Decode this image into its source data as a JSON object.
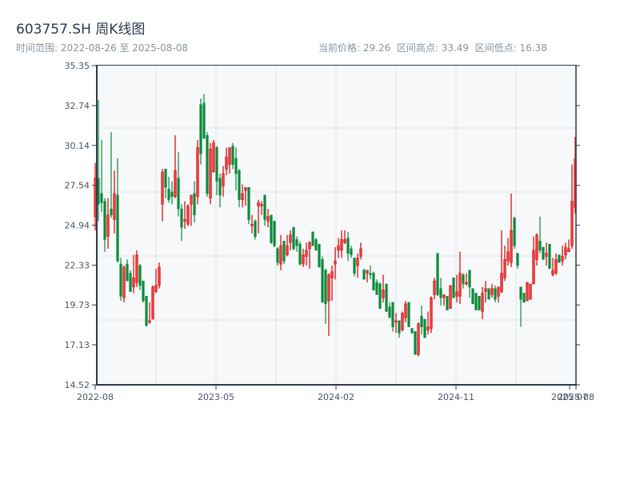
{
  "header": {
    "title": "603757.SH 周K线图",
    "range_text": "时间范围: 2022-08-26 至 2025-08-08",
    "stats_text": "当前价格: 29.26  区间高点: 33.49  区间低点: 16.38"
  },
  "colors": {
    "up": "#d40000",
    "up_fill": "#ee3a3a",
    "down": "#0b8a3b",
    "plot_bg": "#f6f8fa",
    "grid": "#e1e4ea",
    "axis": "#2b3a4e"
  },
  "chart_data": {
    "type": "candlestick",
    "title": "603757.SH 周K线图",
    "start_date": "2022-08-26",
    "end_date": "2025-08-08",
    "frequency": "weekly",
    "current_price": 29.26,
    "period_high": 33.49,
    "period_low": 16.38,
    "ylim": [
      14.52,
      35.35
    ],
    "y_ticks": [
      "14.52",
      "17.13",
      "19.73",
      "22.33",
      "24.94",
      "27.54",
      "30.14",
      "32.74",
      "35.35"
    ],
    "x_ticks": [
      {
        "label": "2022-08",
        "index": 0
      },
      {
        "label": "2023-05",
        "index": 37.75
      },
      {
        "label": "2024-02",
        "index": 75.25
      },
      {
        "label": "2024-11",
        "index": 112.75
      },
      {
        "label": "2025-07",
        "index": 148.25
      },
      {
        "label": "2025-08",
        "index": 150.25
      }
    ],
    "ohlc_fields": [
      "open",
      "high",
      "low",
      "close"
    ],
    "candles": [
      [
        25.5,
        29.0,
        24.6,
        28.0
      ],
      [
        28.0,
        33.1,
        25.2,
        26.3
      ],
      [
        27.0,
        30.5,
        25.8,
        26.4
      ],
      [
        26.5,
        26.7,
        23.2,
        24.0
      ],
      [
        24.2,
        26.7,
        23.4,
        25.6
      ],
      [
        26.0,
        31.0,
        25.4,
        25.6
      ],
      [
        25.3,
        28.5,
        24.4,
        27.0
      ],
      [
        26.9,
        29.3,
        22.5,
        22.6
      ],
      [
        22.4,
        22.8,
        20.0,
        20.3
      ],
      [
        20.2,
        22.3,
        19.9,
        22.2
      ],
      [
        22.4,
        22.7,
        21.3,
        21.3
      ],
      [
        21.8,
        22.0,
        20.6,
        20.6
      ],
      [
        20.9,
        23.0,
        20.5,
        21.5
      ],
      [
        21.2,
        23.3,
        20.9,
        23.0
      ],
      [
        22.3,
        22.4,
        20.7,
        21.0
      ],
      [
        21.3,
        21.3,
        19.9,
        20.0
      ],
      [
        20.3,
        20.3,
        18.3,
        18.4
      ],
      [
        18.6,
        19.9,
        18.5,
        18.7
      ],
      [
        18.8,
        21.0,
        18.8,
        20.9
      ],
      [
        20.6,
        22.1,
        20.5,
        21.0
      ],
      [
        21.0,
        22.5,
        20.8,
        22.2
      ],
      [
        26.3,
        28.6,
        25.2,
        28.4
      ],
      [
        28.6,
        28.6,
        26.7,
        27.4
      ],
      [
        27.3,
        28.1,
        26.4,
        26.6
      ],
      [
        27.1,
        27.8,
        26.3,
        26.8
      ],
      [
        26.8,
        30.8,
        26.7,
        28.5
      ],
      [
        28.0,
        29.7,
        25.5,
        26.0
      ],
      [
        26.0,
        26.3,
        23.9,
        24.8
      ],
      [
        25.2,
        26.5,
        24.7,
        25.3
      ],
      [
        25.0,
        26.3,
        24.9,
        26.2
      ],
      [
        26.3,
        26.9,
        24.9,
        26.9
      ],
      [
        27.0,
        27.8,
        25.1,
        25.6
      ],
      [
        26.8,
        30.5,
        26.3,
        30.0
      ],
      [
        32.8,
        33.2,
        28.9,
        29.6
      ],
      [
        32.9,
        33.49,
        30.6,
        30.6
      ],
      [
        30.8,
        31.0,
        26.8,
        27.0
      ],
      [
        26.7,
        30.3,
        26.3,
        29.9
      ],
      [
        28.4,
        30.5,
        28.4,
        30.3
      ],
      [
        30.0,
        30.1,
        26.9,
        27.8
      ],
      [
        28.0,
        28.3,
        26.1,
        26.9
      ],
      [
        27.5,
        28.8,
        26.8,
        28.3
      ],
      [
        28.6,
        30.0,
        28.2,
        29.4
      ],
      [
        28.9,
        30.0,
        28.3,
        30.0
      ],
      [
        30.1,
        30.3,
        28.6,
        28.9
      ],
      [
        29.3,
        30.0,
        27.2,
        28.3
      ],
      [
        28.5,
        28.6,
        26.1,
        26.6
      ],
      [
        26.6,
        27.6,
        26.1,
        27.0
      ],
      [
        27.2,
        27.4,
        26.2,
        27.4
      ],
      [
        27.4,
        27.4,
        25.0,
        25.3
      ],
      [
        24.9,
        25.6,
        24.4,
        25.0
      ],
      [
        25.2,
        25.3,
        24.0,
        24.2
      ],
      [
        26.2,
        26.6,
        24.4,
        26.4
      ],
      [
        26.2,
        26.5,
        25.6,
        26.3
      ],
      [
        26.9,
        26.9,
        24.9,
        25.3
      ],
      [
        25.2,
        26.0,
        24.8,
        25.5
      ],
      [
        25.6,
        25.6,
        23.7,
        23.8
      ],
      [
        25.2,
        25.2,
        23.5,
        23.6
      ],
      [
        23.4,
        23.5,
        22.3,
        22.5
      ],
      [
        22.4,
        24.3,
        22.0,
        23.6
      ],
      [
        23.9,
        23.9,
        22.4,
        22.6
      ],
      [
        23.0,
        24.3,
        22.9,
        23.6
      ],
      [
        23.8,
        24.6,
        23.3,
        24.3
      ],
      [
        24.8,
        24.8,
        23.3,
        23.4
      ],
      [
        24.0,
        24.2,
        23.2,
        23.6
      ],
      [
        23.7,
        23.9,
        22.3,
        22.4
      ],
      [
        22.4,
        23.4,
        22.2,
        23.0
      ],
      [
        22.9,
        23.8,
        22.3,
        23.3
      ],
      [
        23.4,
        23.9,
        22.1,
        23.8
      ],
      [
        24.5,
        24.5,
        23.6,
        23.6
      ],
      [
        24.0,
        24.1,
        23.3,
        23.3
      ],
      [
        23.7,
        23.7,
        22.2,
        22.2
      ],
      [
        22.7,
        22.9,
        19.9,
        19.9
      ],
      [
        22.0,
        22.1,
        18.5,
        19.8
      ],
      [
        20.0,
        21.8,
        17.7,
        21.7
      ],
      [
        21.5,
        22.3,
        20.0,
        21.9
      ],
      [
        22.4,
        23.5,
        21.4,
        22.6
      ],
      [
        23.3,
        24.1,
        22.8,
        23.6
      ],
      [
        23.3,
        24.6,
        22.8,
        24.0
      ],
      [
        23.8,
        24.6,
        23.7,
        24.0
      ],
      [
        24.1,
        24.5,
        22.6,
        23.1
      ],
      [
        23.4,
        23.6,
        22.8,
        23.0
      ],
      [
        22.8,
        22.8,
        21.6,
        21.8
      ],
      [
        22.3,
        23.1,
        21.5,
        22.8
      ],
      [
        22.9,
        23.8,
        22.7,
        23.4
      ],
      [
        22.0,
        22.1,
        21.4,
        21.4
      ],
      [
        21.8,
        22.0,
        21.2,
        22.0
      ],
      [
        21.8,
        22.3,
        21.4,
        21.7
      ],
      [
        21.8,
        21.9,
        20.7,
        20.7
      ],
      [
        21.2,
        21.4,
        20.4,
        20.4
      ],
      [
        21.1,
        21.2,
        19.5,
        19.5
      ],
      [
        20.2,
        21.7,
        19.9,
        20.7
      ],
      [
        21.1,
        21.1,
        19.3,
        19.3
      ],
      [
        19.6,
        19.9,
        18.9,
        18.9
      ],
      [
        19.9,
        19.9,
        18.0,
        18.3
      ],
      [
        18.6,
        19.2,
        17.9,
        18.7
      ],
      [
        18.7,
        18.7,
        17.6,
        17.9
      ],
      [
        18.1,
        19.3,
        18.0,
        19.2
      ],
      [
        18.9,
        20.0,
        18.6,
        19.8
      ],
      [
        19.9,
        19.9,
        18.3,
        18.3
      ],
      [
        18.2,
        18.2,
        17.9,
        17.9
      ],
      [
        18.0,
        18.0,
        16.5,
        16.5
      ],
      [
        16.5,
        18.6,
        16.38,
        18.5
      ],
      [
        19.0,
        19.7,
        17.8,
        18.3
      ],
      [
        18.8,
        18.8,
        17.6,
        17.6
      ],
      [
        18.1,
        19.3,
        17.8,
        18.3
      ],
      [
        18.2,
        20.3,
        17.9,
        20.2
      ],
      [
        20.4,
        21.5,
        20.1,
        21.3
      ],
      [
        23.1,
        23.1,
        20.3,
        20.4
      ],
      [
        20.8,
        21.5,
        19.7,
        20.2
      ],
      [
        20.2,
        20.4,
        19.7,
        20.4
      ],
      [
        20.3,
        20.3,
        19.4,
        19.4
      ],
      [
        19.5,
        21.0,
        19.5,
        21.0
      ],
      [
        21.5,
        21.5,
        20.2,
        20.2
      ],
      [
        20.3,
        21.7,
        19.9,
        20.6
      ],
      [
        20.3,
        23.2,
        19.8,
        21.8
      ],
      [
        21.7,
        21.8,
        20.8,
        21.1
      ],
      [
        21.1,
        21.8,
        21.0,
        21.2
      ],
      [
        22.0,
        22.0,
        20.2,
        20.9
      ],
      [
        20.8,
        20.8,
        19.8,
        19.8
      ],
      [
        20.5,
        20.5,
        19.4,
        19.4
      ],
      [
        20.3,
        20.3,
        19.4,
        19.4
      ],
      [
        19.3,
        20.9,
        18.8,
        20.5
      ],
      [
        20.6,
        21.3,
        19.9,
        20.8
      ],
      [
        20.8,
        20.8,
        20.1,
        20.1
      ],
      [
        20.4,
        21.1,
        20.2,
        20.8
      ],
      [
        20.8,
        21.0,
        19.9,
        20.1
      ],
      [
        20.3,
        20.9,
        19.9,
        20.9
      ],
      [
        20.6,
        24.6,
        20.5,
        21.8
      ],
      [
        21.5,
        23.6,
        21.3,
        22.7
      ],
      [
        22.6,
        24.1,
        22.3,
        23.2
      ],
      [
        22.5,
        27.0,
        22.2,
        24.6
      ],
      [
        25.4,
        25.5,
        23.4,
        23.6
      ],
      [
        23.1,
        23.1,
        22.1,
        22.3
      ],
      [
        20.9,
        20.9,
        18.3,
        20.1
      ],
      [
        20.5,
        20.5,
        19.9,
        19.9
      ],
      [
        20.0,
        21.2,
        20.0,
        21.2
      ],
      [
        20.1,
        21.1,
        20.1,
        21.1
      ],
      [
        21.1,
        24.2,
        21.1,
        23.3
      ],
      [
        22.7,
        24.4,
        22.3,
        24.3
      ],
      [
        23.9,
        25.5,
        23.1,
        23.3
      ],
      [
        23.5,
        23.5,
        22.7,
        22.7
      ],
      [
        22.9,
        23.8,
        22.3,
        23.1
      ],
      [
        23.7,
        23.7,
        22.1,
        22.1
      ],
      [
        21.7,
        22.8,
        21.6,
        22.0
      ],
      [
        21.8,
        23.1,
        21.7,
        22.7
      ],
      [
        23.0,
        23.0,
        22.5,
        22.5
      ],
      [
        22.6,
        23.6,
        22.3,
        22.9
      ],
      [
        23.0,
        23.8,
        22.7,
        23.5
      ],
      [
        23.2,
        24.0,
        23.2,
        23.4
      ],
      [
        23.6,
        28.9,
        23.4,
        26.5
      ],
      [
        26.1,
        30.7,
        25.7,
        29.26
      ]
    ]
  }
}
